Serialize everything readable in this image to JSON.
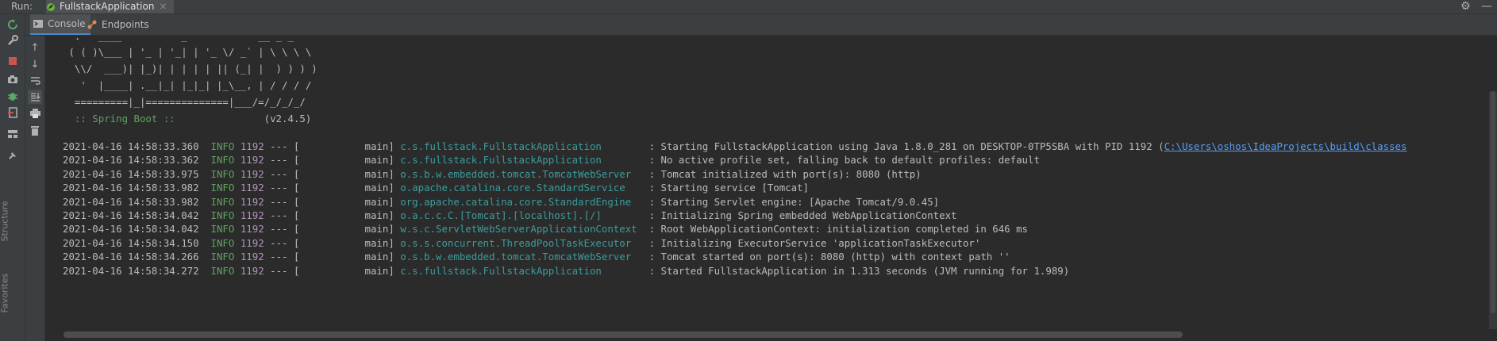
{
  "runbar": {
    "label": "Run:",
    "tab_title": "FullstackApplication",
    "close_glyph": "×",
    "settings_icon": "gear-icon",
    "minimize_icon": "minimize-icon"
  },
  "tabs": [
    {
      "label": "Console",
      "icon": "console-icon"
    },
    {
      "label": "Endpoints",
      "icon": "endpoints-icon"
    }
  ],
  "left_toolbar": {
    "buttons": [
      "rerun-icon",
      "wrench-icon",
      "stop-icon",
      "camera-icon",
      "debug-icon",
      "exit-icon",
      "layout-icon",
      "pin-icon"
    ],
    "vertical_labels": [
      "Structure",
      "Favorites"
    ]
  },
  "sub_toolbar": {
    "buttons": [
      "arrow-up-icon",
      "arrow-down-icon",
      "soft-wrap-icon",
      "scroll-to-end-icon",
      "print-icon",
      "trash-icon"
    ]
  },
  "console": {
    "banner": [
      " ( ( )\\___ | '_ | '_| | '_ \\/ _` | \\ \\ \\ \\",
      "  \\\\/  ___)| |_)| | | | | || (_| |  ) ) ) )",
      "   '  |____| .__|_| |_|_| |_\\__, | / / / /",
      "  =========|_|==============|___/=/_/_/_/"
    ],
    "spring_label": "  :: Spring Boot ::               ",
    "spring_version": "(v2.4.5)",
    "logs": [
      {
        "ts": "2021-04-16 14:58:33.360",
        "level": "INFO",
        "pid": "1192",
        "thread": "           main]",
        "logger": "c.s.fullstack.FullstackApplication       ",
        "msg": ": Starting FullstackApplication using Java 1.8.0_281 on DESKTOP-0TP5SBA with PID 1192 (",
        "link": "C:\\Users\\oshos\\IdeaProjects\\build\\classes"
      },
      {
        "ts": "2021-04-16 14:58:33.362",
        "level": "INFO",
        "pid": "1192",
        "thread": "           main]",
        "logger": "c.s.fullstack.FullstackApplication       ",
        "msg": ": No active profile set, falling back to default profiles: default",
        "link": ""
      },
      {
        "ts": "2021-04-16 14:58:33.975",
        "level": "INFO",
        "pid": "1192",
        "thread": "           main]",
        "logger": "o.s.b.w.embedded.tomcat.TomcatWebServer  ",
        "msg": ": Tomcat initialized with port(s): 8080 (http)",
        "link": ""
      },
      {
        "ts": "2021-04-16 14:58:33.982",
        "level": "INFO",
        "pid": "1192",
        "thread": "           main]",
        "logger": "o.apache.catalina.core.StandardService   ",
        "msg": ": Starting service [Tomcat]",
        "link": ""
      },
      {
        "ts": "2021-04-16 14:58:33.982",
        "level": "INFO",
        "pid": "1192",
        "thread": "           main]",
        "logger": "org.apache.catalina.core.StandardEngine  ",
        "msg": ": Starting Servlet engine: [Apache Tomcat/9.0.45]",
        "link": ""
      },
      {
        "ts": "2021-04-16 14:58:34.042",
        "level": "INFO",
        "pid": "1192",
        "thread": "           main]",
        "logger": "o.a.c.c.C.[Tomcat].[localhost].[/]       ",
        "msg": ": Initializing Spring embedded WebApplicationContext",
        "link": ""
      },
      {
        "ts": "2021-04-16 14:58:34.042",
        "level": "INFO",
        "pid": "1192",
        "thread": "           main]",
        "logger": "w.s.c.ServletWebServerApplicationContext ",
        "msg": ": Root WebApplicationContext: initialization completed in 646 ms",
        "link": ""
      },
      {
        "ts": "2021-04-16 14:58:34.150",
        "level": "INFO",
        "pid": "1192",
        "thread": "           main]",
        "logger": "o.s.s.concurrent.ThreadPoolTaskExecutor  ",
        "msg": ": Initializing ExecutorService 'applicationTaskExecutor'",
        "link": ""
      },
      {
        "ts": "2021-04-16 14:58:34.266",
        "level": "INFO",
        "pid": "1192",
        "thread": "           main]",
        "logger": "o.s.b.w.embedded.tomcat.TomcatWebServer  ",
        "msg": ": Tomcat started on port(s): 8080 (http) with context path ''",
        "link": ""
      },
      {
        "ts": "2021-04-16 14:58:34.272",
        "level": "INFO",
        "pid": "1192",
        "thread": "           main]",
        "logger": "c.s.fullstack.FullstackApplication       ",
        "msg": ": Started FullstackApplication in 1.313 seconds (JVM running for 1.989)",
        "link": ""
      }
    ]
  }
}
